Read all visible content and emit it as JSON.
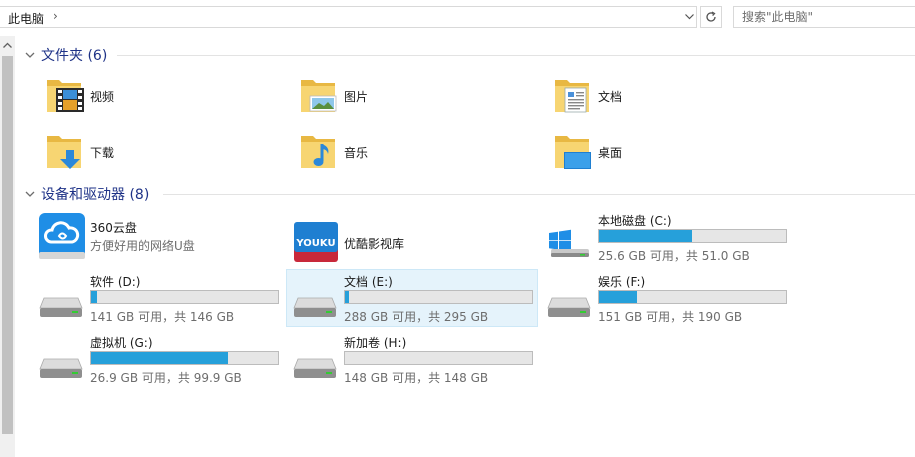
{
  "address_bar": {
    "path": "此电脑",
    "separator": "›",
    "search_placeholder": "搜索\"此电脑\""
  },
  "groups": {
    "folders": {
      "title": "文件夹 (6)",
      "items": [
        {
          "label": "视频",
          "icon": "video-folder-icon"
        },
        {
          "label": "图片",
          "icon": "pictures-folder-icon"
        },
        {
          "label": "文档",
          "icon": "documents-folder-icon"
        },
        {
          "label": "下载",
          "icon": "downloads-folder-icon"
        },
        {
          "label": "音乐",
          "icon": "music-folder-icon"
        },
        {
          "label": "桌面",
          "icon": "desktop-folder-icon"
        }
      ]
    },
    "devices": {
      "title": "设备和驱动器 (8)",
      "apps": [
        {
          "name": "360云盘",
          "subtitle": "方便好用的网络U盘",
          "icon": "360-cloud-icon"
        },
        {
          "name": "优酷影视库",
          "icon": "youku-icon",
          "icon_text": "YOUKU"
        }
      ],
      "drives": [
        {
          "name": "本地磁盘 (C:)",
          "free": "25.6 GB 可用，共 51.0 GB",
          "used_fraction": 0.498,
          "icon": "windows-drive-icon"
        },
        {
          "name": "软件 (D:)",
          "free": "141 GB 可用，共 146 GB",
          "used_fraction": 0.034,
          "icon": "hard-drive-icon"
        },
        {
          "name": "文档 (E:)",
          "free": "288 GB 可用，共 295 GB",
          "used_fraction": 0.024,
          "icon": "hard-drive-icon",
          "selected": true
        },
        {
          "name": "娱乐 (F:)",
          "free": "151 GB 可用，共 190 GB",
          "used_fraction": 0.205,
          "icon": "hard-drive-icon"
        },
        {
          "name": "虚拟机 (G:)",
          "free": "26.9 GB 可用，共 99.9 GB",
          "used_fraction": 0.731,
          "icon": "hard-drive-icon"
        },
        {
          "name": "新加卷 (H:)",
          "free": "148 GB 可用，共 148 GB",
          "used_fraction": 0.0,
          "icon": "hard-drive-icon"
        }
      ]
    }
  },
  "colors": {
    "accent_bar": "#26a0da",
    "group_title": "#1e3287",
    "selection": "#e5f3fb"
  }
}
